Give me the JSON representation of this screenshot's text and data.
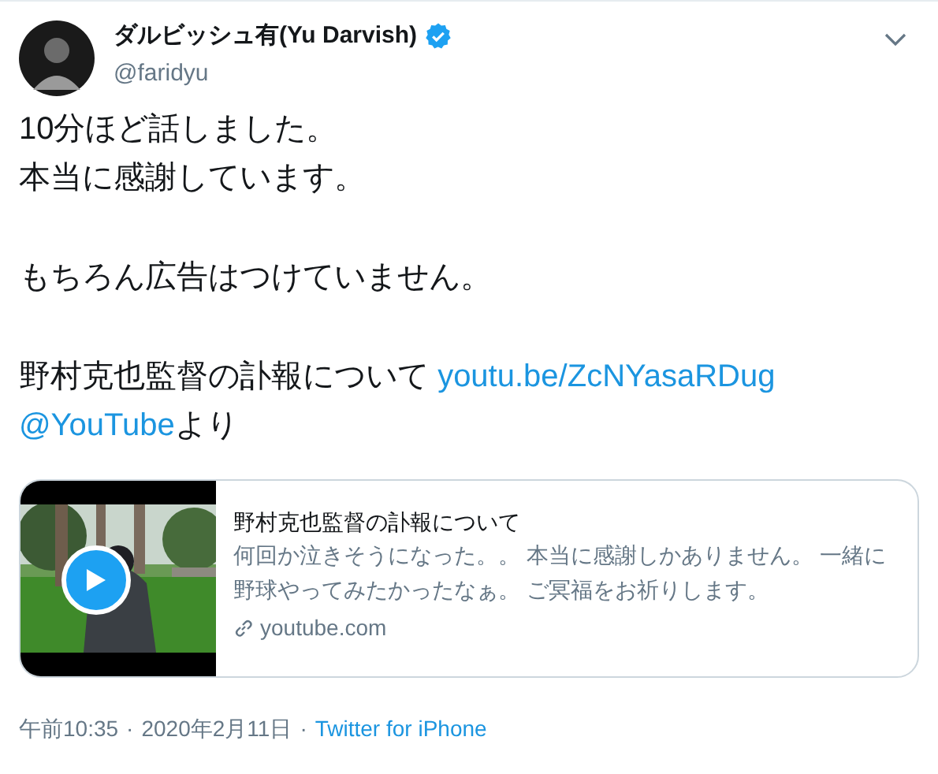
{
  "author": {
    "name": "ダルビッシュ有(Yu Darvish)",
    "verified": true,
    "handle": "@faridyu"
  },
  "body": [
    [
      [
        {
          "kind": "text",
          "text": "10分ほど話しました。"
        }
      ],
      [
        {
          "kind": "text",
          "text": "本当に感謝しています。"
        }
      ]
    ],
    [
      [
        {
          "kind": "text",
          "text": "もちろん広告はつけていません。"
        }
      ]
    ],
    [
      [
        {
          "kind": "text",
          "text": "野村克也監督の訃報について "
        },
        {
          "kind": "link",
          "text": "youtu.be/ZcNYasaRDug"
        }
      ],
      [
        {
          "kind": "link",
          "text": "@YouTube"
        },
        {
          "kind": "text",
          "text": "より"
        }
      ]
    ]
  ],
  "card": {
    "title": "野村克也監督の訃報について",
    "description": "何回か泣きそうになった。。 本当に感謝しかありません。 一緒に野球やってみたかったなぁ。 ご冥福をお祈りします。",
    "domain": "youtube.com"
  },
  "footer": {
    "time": "午前10:35",
    "separator_1": "·",
    "date": "2020年2月11日",
    "separator_2": "·",
    "source": "Twitter for iPhone"
  }
}
